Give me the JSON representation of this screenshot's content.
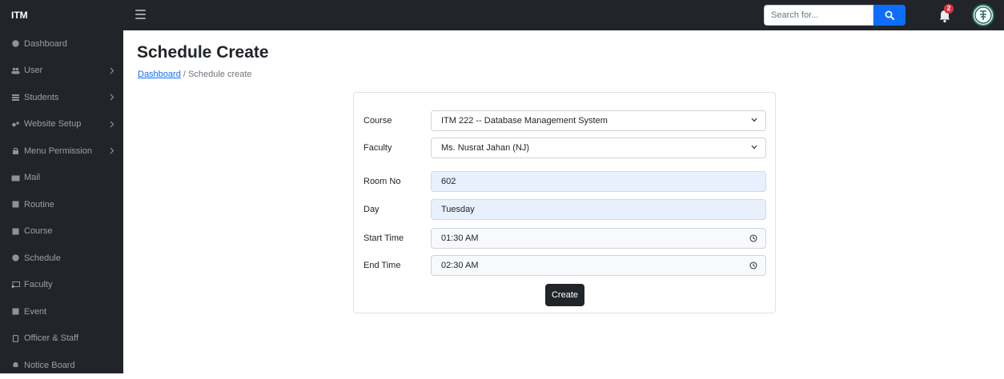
{
  "topbar": {
    "brand": "ITM",
    "search_placeholder": "Search for...",
    "notification_count": "2"
  },
  "sidebar": {
    "items": [
      {
        "label": "Dashboard",
        "icon": "gauge-icon",
        "has_children": false
      },
      {
        "label": "User",
        "icon": "users-icon",
        "has_children": true
      },
      {
        "label": "Students",
        "icon": "students-icon",
        "has_children": true
      },
      {
        "label": "Website Setup",
        "icon": "gears-icon",
        "has_children": true
      },
      {
        "label": "Menu Permission",
        "icon": "lock-icon",
        "has_children": true
      },
      {
        "label": "Mail",
        "icon": "envelope-icon",
        "has_children": false
      },
      {
        "label": "Routine",
        "icon": "table-icon",
        "has_children": false
      },
      {
        "label": "Course",
        "icon": "book-icon",
        "has_children": false
      },
      {
        "label": "Schedule",
        "icon": "clock-icon",
        "has_children": false
      },
      {
        "label": "Faculty",
        "icon": "chalkboard-icon",
        "has_children": false
      },
      {
        "label": "Event",
        "icon": "calendar-icon",
        "has_children": false
      },
      {
        "label": "Officer & Staff",
        "icon": "id-card-icon",
        "has_children": false
      },
      {
        "label": "Notice Board",
        "icon": "bell-icon",
        "has_children": false
      }
    ]
  },
  "page": {
    "title": "Schedule Create",
    "breadcrumb_link": "Dashboard",
    "breadcrumb_sep": "/",
    "breadcrumb_current": "Schedule create"
  },
  "form": {
    "course": {
      "label": "Course",
      "value": "ITM 222 -- Database Management System"
    },
    "faculty": {
      "label": "Faculty",
      "value": "Ms. Nusrat Jahan (NJ)"
    },
    "room": {
      "label": "Room No",
      "value": "602"
    },
    "day": {
      "label": "Day",
      "value": "Tuesday"
    },
    "start_time": {
      "label": "Start Time",
      "value": "01:30 AM"
    },
    "end_time": {
      "label": "End Time",
      "value": "02:30 AM"
    },
    "submit_label": "Create"
  },
  "colors": {
    "sidebar_bg": "#212529",
    "accent": "#0d6efd",
    "badge": "#dc3545",
    "autofill_bg": "#e8f0fe"
  }
}
